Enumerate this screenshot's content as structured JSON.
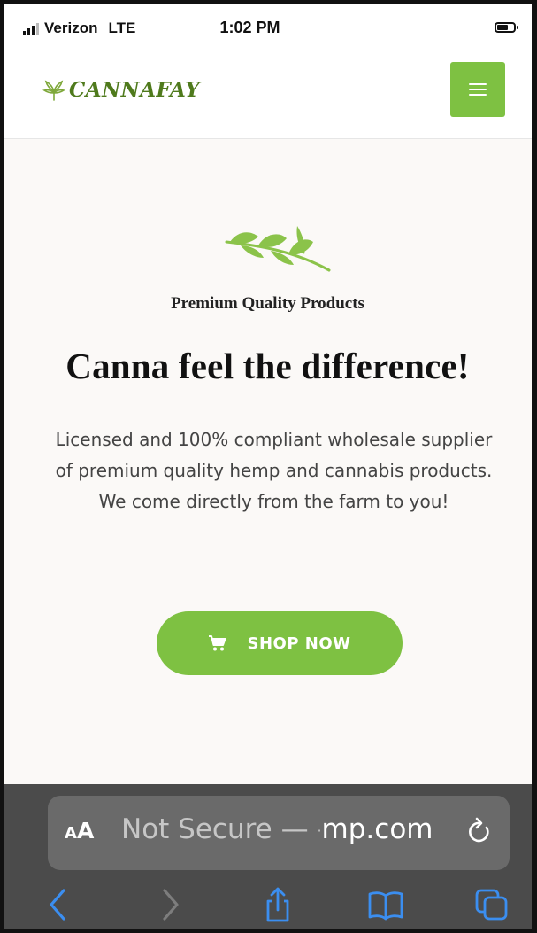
{
  "status_bar": {
    "carrier": "Verizon",
    "network": "LTE",
    "time": "1:02 PM"
  },
  "header": {
    "logo_text": "CANNAFAY",
    "menu_icon": "hamburger-icon"
  },
  "hero": {
    "tagline": "Premium Quality Products",
    "headline": "Canna feel the difference!",
    "description": "Licensed and 100% compliant wholesale supplier of premium quality hemp and cannabis products. We come directly from the farm to you!",
    "cta_label": "SHOP NOW",
    "cta_icon": "cart-icon"
  },
  "browser": {
    "text_size_label_small": "A",
    "text_size_label_big": "A",
    "url_prefix": "Not Secure — ",
    "url_fragment": "·",
    "url_domain": "mp.com",
    "toolbar": [
      "back-icon",
      "forward-icon",
      "share-icon",
      "bookmarks-icon",
      "tabs-icon"
    ]
  },
  "colors": {
    "accent_green": "#7ec142",
    "logo_green": "#4f7a1c",
    "hero_background": "#fbf9f7",
    "safari_chrome": "#4b4b4b",
    "ios_blue": "#3b8ef0"
  }
}
